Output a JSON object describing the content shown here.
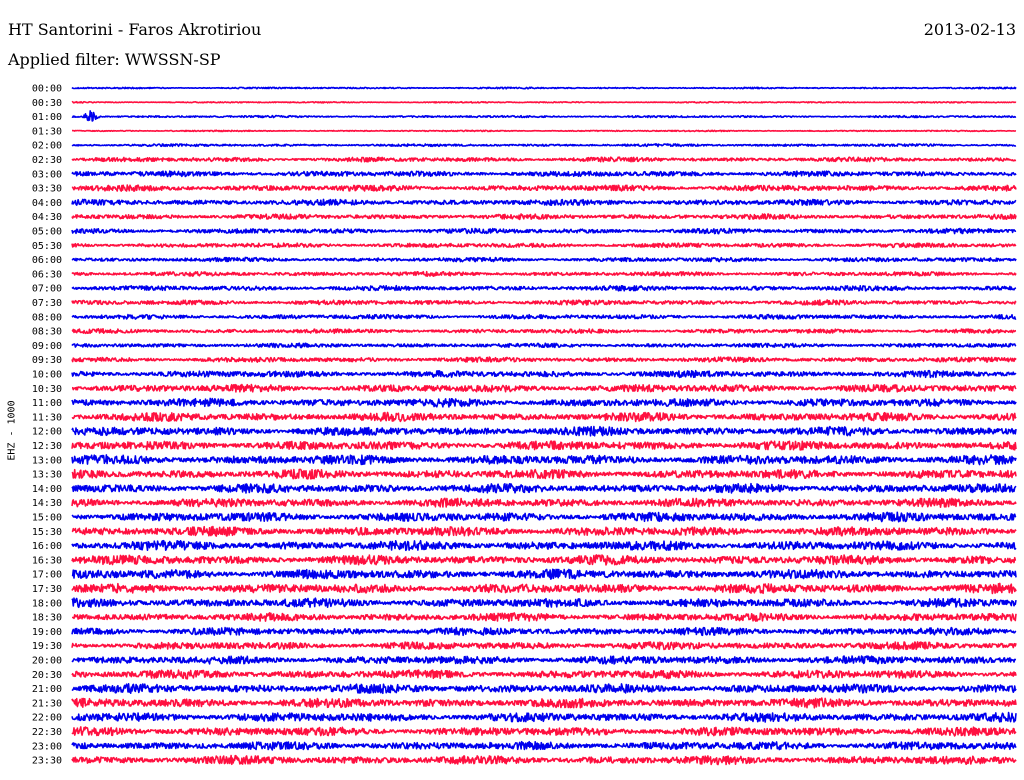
{
  "header": {
    "station": "HT Santorini - Faros Akrotiriou",
    "date": "2013-02-13",
    "filter": "Applied filter: WWSSN-SP"
  },
  "channel_label": "EHZ - 1000",
  "colors": {
    "trace_a": "#0000ee",
    "trace_b": "#ff1040",
    "background": "#ffffff"
  },
  "chart_data": {
    "type": "line",
    "title": "HT Santorini - Faros Akrotiriou",
    "subtitle": "Applied filter: WWSSN-SP",
    "ylabel": "EHZ - 1000",
    "row_labels": [
      "00:00",
      "00:30",
      "01:00",
      "01:30",
      "02:00",
      "02:30",
      "03:00",
      "03:30",
      "04:00",
      "04:30",
      "05:00",
      "05:30",
      "06:00",
      "06:30",
      "07:00",
      "07:30",
      "08:00",
      "08:30",
      "09:00",
      "09:30",
      "10:00",
      "10:30",
      "11:00",
      "11:30",
      "12:00",
      "12:30",
      "13:00",
      "13:30",
      "14:00",
      "14:30",
      "15:00",
      "15:30",
      "16:00",
      "16:30",
      "17:00",
      "17:30",
      "18:00",
      "18:30",
      "19:00",
      "19:30",
      "20:00",
      "20:30",
      "21:00",
      "21:30",
      "22:00",
      "22:30",
      "23:00",
      "23:30"
    ],
    "row_colors": [
      "#0000ee",
      "#ff1040"
    ],
    "relative_noise_amplitude": [
      0.6,
      0.5,
      0.8,
      0.5,
      1.0,
      1.8,
      2.2,
      2.4,
      2.3,
      2.0,
      2.0,
      1.8,
      1.7,
      1.7,
      2.0,
      1.9,
      1.8,
      1.7,
      1.7,
      2.0,
      2.6,
      3.0,
      3.3,
      3.4,
      3.5,
      3.6,
      3.8,
      3.6,
      3.6,
      3.5,
      3.6,
      3.7,
      3.8,
      3.7,
      3.8,
      3.8,
      3.5,
      3.2,
      3.0,
      3.0,
      3.3,
      3.4,
      3.6,
      3.7,
      3.6,
      3.5,
      3.3,
      3.4
    ],
    "events": [
      {
        "row": "01:00",
        "position": 0.02,
        "relative_amplitude": 6
      }
    ],
    "grid": false,
    "legend": "none"
  }
}
